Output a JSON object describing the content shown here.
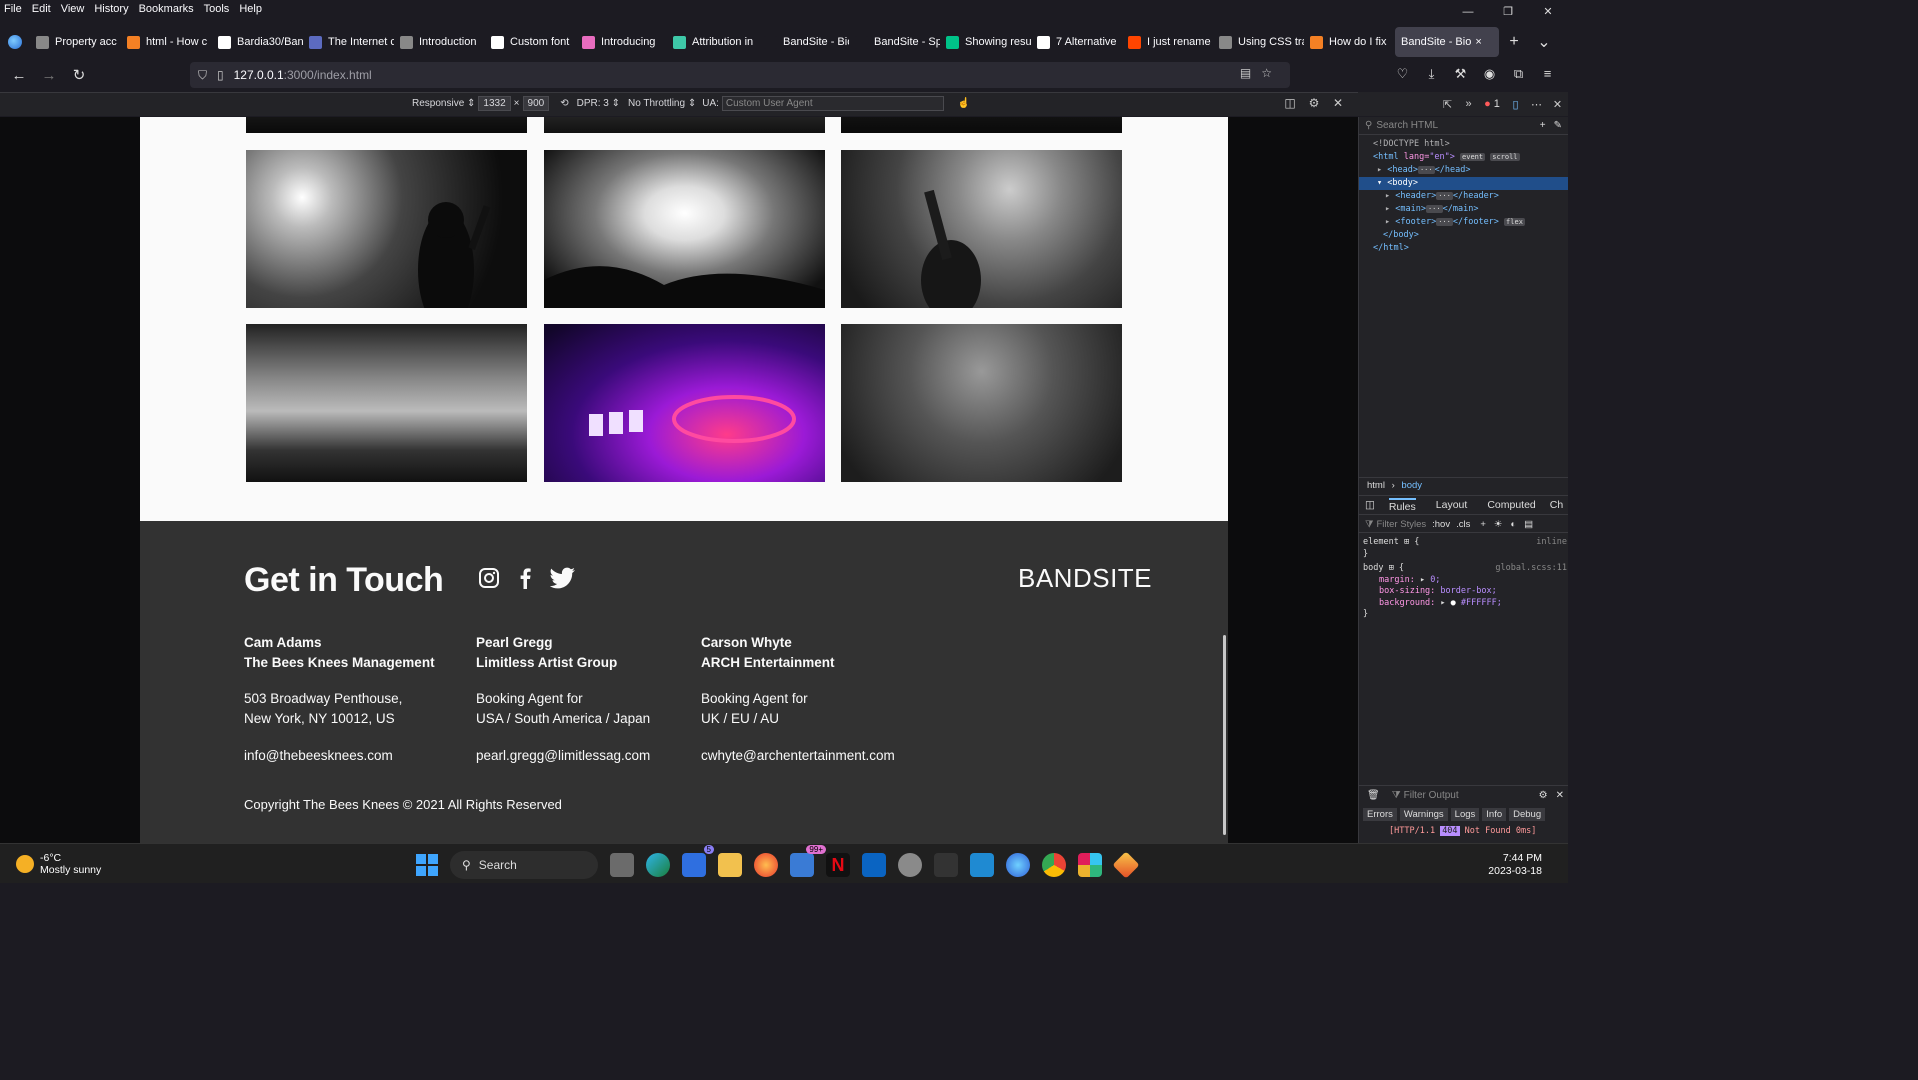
{
  "menu": [
    "File",
    "Edit",
    "View",
    "History",
    "Bookmarks",
    "Tools",
    "Help"
  ],
  "tabs": [
    {
      "label": "Property acc",
      "color": "#888888"
    },
    {
      "label": "html - How c",
      "color": "#f48024"
    },
    {
      "label": "Bardia30/Ban",
      "color": "#ffffff"
    },
    {
      "label": "The Internet c",
      "color": "#5c6bc0"
    },
    {
      "label": "Introduction",
      "color": "#888888"
    },
    {
      "label": "Custom font",
      "color": "#ffffff"
    },
    {
      "label": "Introducing",
      "color": "#e86cbf"
    },
    {
      "label": "Attribution in",
      "color": "#3ec8a8"
    },
    {
      "label": "BandSite - Biogra",
      "color": "#1c1b22"
    },
    {
      "label": "BandSite - Sp",
      "color": "#1c1b22"
    },
    {
      "label": "Showing resu",
      "color": "#00c389"
    },
    {
      "label": "7 Alternative",
      "color": "#ffffff"
    },
    {
      "label": "I just rename",
      "color": "#ff4500"
    },
    {
      "label": "Using CSS tra",
      "color": "#888888"
    },
    {
      "label": "How do I fix",
      "color": "#f48024"
    }
  ],
  "active_tab": {
    "label": "BandSite - Bio",
    "close": "×"
  },
  "url": {
    "host": "127.0.0.1",
    "path": ":3000/index.html"
  },
  "rdm": {
    "device": "Responsive ⇕",
    "width": "1332",
    "times": "×",
    "height": "900",
    "dpr": "DPR: 3 ⇕",
    "throttling": "No Throttling ⇕",
    "ua_label": "UA:",
    "ua_placeholder": "Custom User Agent"
  },
  "footer": {
    "heading": "Get in Touch",
    "brand": "BANDSITE",
    "contacts": [
      {
        "name": "Cam Adams",
        "company": "The Bees Knees Management",
        "line1": "503 Broadway Penthouse,",
        "line2": "New York, NY 10012, US",
        "email": "info@thebeesknees.com"
      },
      {
        "name": "Pearl Gregg",
        "company": "Limitless Artist Group",
        "line1": "Booking Agent for",
        "line2": "USA / South America / Japan",
        "email": "pearl.gregg@limitlessag.com"
      },
      {
        "name": "Carson Whyte",
        "company": "ARCH Entertainment",
        "line1": "Booking Agent for",
        "line2": "UK / EU / AU",
        "email": "cwhyte@archentertainment.com"
      }
    ],
    "copyright": "Copyright The Bees Knees © 2021 All Rights Reserved"
  },
  "devtools": {
    "search_placeholder": "Search HTML",
    "error_count": "1",
    "tree": {
      "doctype": "<!DOCTYPE html>",
      "html_open": "<html",
      "lang_attr": "lang=",
      "lang_val": "\"en\">",
      "badge_event": "event",
      "badge_scroll": "scroll",
      "head": "<head>",
      "head_close": "</head>",
      "body": "<body>",
      "header": "<header>",
      "header_close": "</header>",
      "main": "<main>",
      "main_close": "</main>",
      "footer": "<footer>",
      "footer_close": "</footer>",
      "badge_flex": "flex",
      "body_close": "</body>",
      "html_close": "</html>",
      "ellipsis": "···"
    },
    "breadcrumb": {
      "first": "html",
      "sep": "›",
      "second": "body"
    },
    "panel_tabs": [
      "Rules",
      "Layout",
      "Computed",
      "Ch"
    ],
    "filter_placeholder": "Filter Styles",
    "filter_hov": ":hov",
    "filter_cls": ".cls",
    "rules": {
      "element_sel": "element",
      "inline_src": "inline",
      "body_sel": "body",
      "src": "global.scss:11",
      "margin_prop": "margin:",
      "margin_val": "0;",
      "box_prop": "box-sizing:",
      "box_val": "border-box;",
      "bg_prop": "background:",
      "bg_val": "#FFFFFF;",
      "open_brace": "{",
      "close_brace": "}"
    },
    "console": {
      "filter_placeholder": "Filter Output",
      "buttons": [
        "Errors",
        "Warnings",
        "Logs",
        "Info",
        "Debug"
      ],
      "error_pre": "[HTTP/1.1",
      "error_code": "404",
      "error_post": "Not Found 0ms]"
    }
  },
  "taskbar": {
    "temp": "-6°C",
    "condition": "Mostly sunny",
    "search": "Search",
    "badge_todo": "5",
    "badge_mail": "99+",
    "time": "7:44 PM",
    "date": "2023-03-18"
  }
}
